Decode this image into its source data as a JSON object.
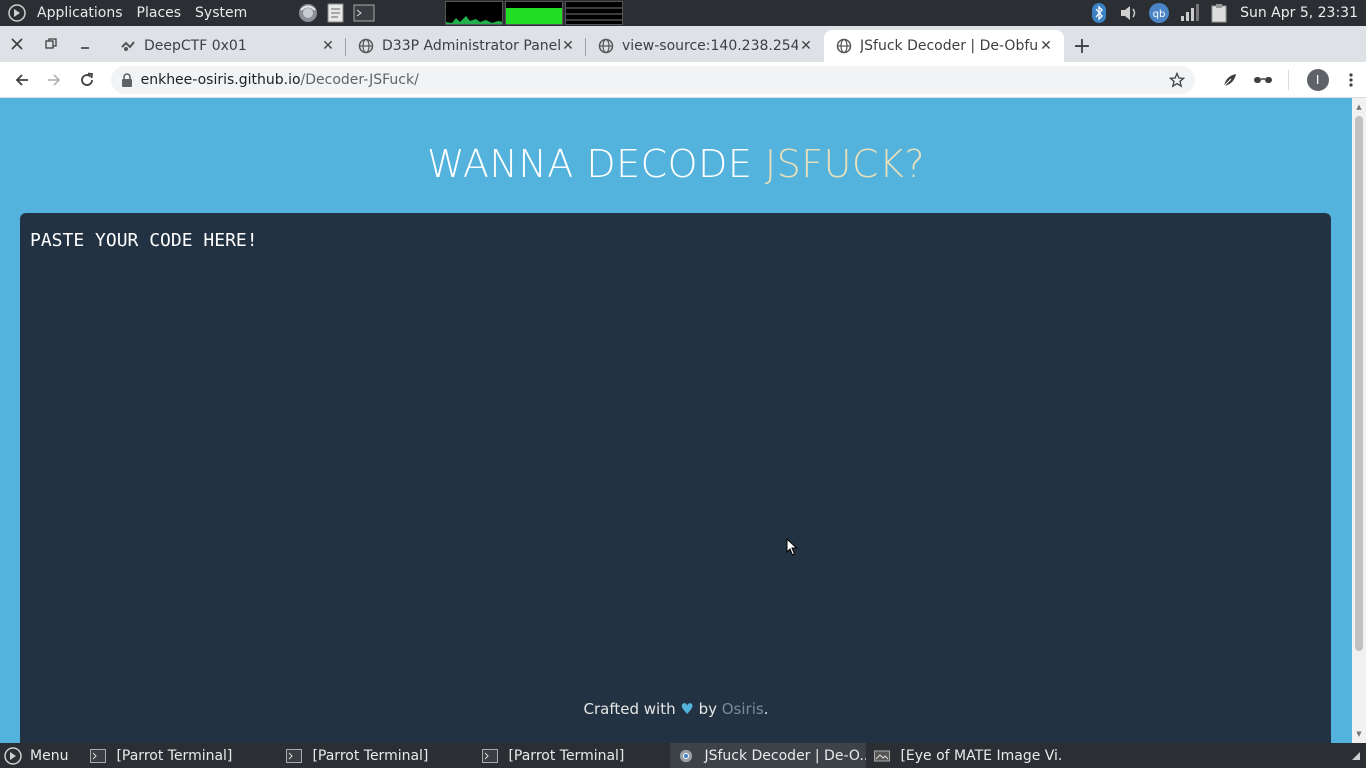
{
  "panel": {
    "applications": "Applications",
    "places": "Places",
    "system": "System",
    "clock": "Sun Apr  5, 23:31"
  },
  "tabs": [
    {
      "title": "DeepCTF 0x01",
      "icon": "ctf-favicon-icon"
    },
    {
      "title": "D33P Administrator Panel",
      "icon": "globe-icon"
    },
    {
      "title": "view-source:140.238.254.",
      "icon": "globe-icon"
    },
    {
      "title": "JSfuck Decoder | De-Obfu",
      "icon": "globe-icon",
      "active": true
    }
  ],
  "toolbar": {
    "url_host": "enkhee-osiris.github.io",
    "url_path": "/Decoder-JSFuck/",
    "profile_initial": "I"
  },
  "page": {
    "heading_white": "WANNA DECODE ",
    "heading_accent": "JSFUCK?",
    "code_placeholder": "PASTE YOUR CODE HERE!",
    "footer_prefix": "Crafted with ",
    "footer_heart": "♥",
    "footer_by": " by ",
    "footer_author": "Osiris",
    "footer_suffix": "."
  },
  "taskbar": {
    "menu": "Menu",
    "items": [
      {
        "label": "[Parrot Terminal]",
        "icon": "terminal-icon"
      },
      {
        "label": "[Parrot Terminal]",
        "icon": "terminal-icon"
      },
      {
        "label": "[Parrot Terminal]",
        "icon": "terminal-icon"
      },
      {
        "label": "JSfuck Decoder | De-O...",
        "icon": "chrome-icon",
        "active": true
      },
      {
        "label": "[Eye of MATE Image Vi...",
        "icon": "image-viewer-icon"
      }
    ]
  },
  "colors": {
    "page_bg": "#54b3dc",
    "code_bg": "#233242",
    "heading_accent": "#e7e0bb",
    "panel_bg": "#2b2e33"
  }
}
